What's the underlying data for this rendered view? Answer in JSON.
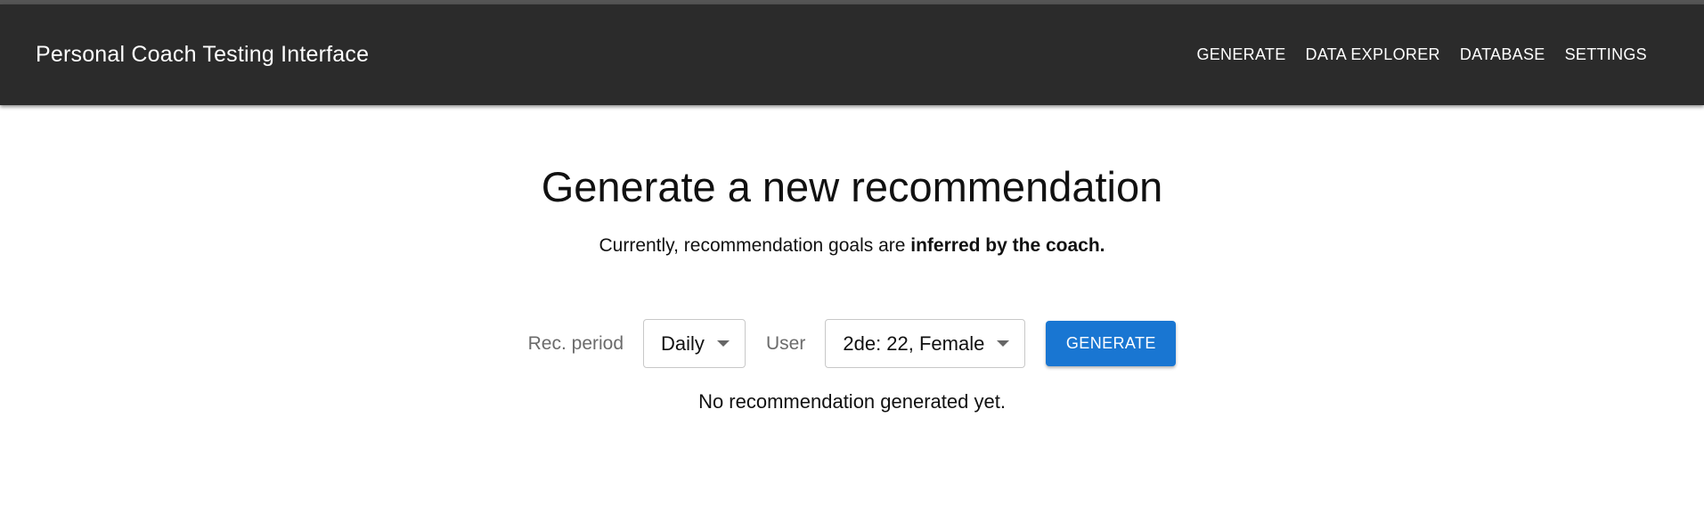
{
  "app_bar": {
    "title": "Personal Coach Testing Interface",
    "nav": [
      "Generate",
      "Data Explorer",
      "Database",
      "Settings"
    ]
  },
  "main": {
    "title": "Generate a new recommendation",
    "subtitle_prefix": "Currently, recommendation goals are ",
    "subtitle_bold": "inferred by the coach.",
    "rec_period_label": "Rec. period",
    "rec_period_value": "Daily",
    "user_label": "User",
    "user_value": "2de: 22, Female",
    "generate_label": "Generate",
    "status": "No recommendation generated yet."
  },
  "colors": {
    "app_bar_bg": "#2b2b2b",
    "primary": "#1976d2"
  },
  "icons": {
    "select_caret": "caret-down-icon"
  }
}
